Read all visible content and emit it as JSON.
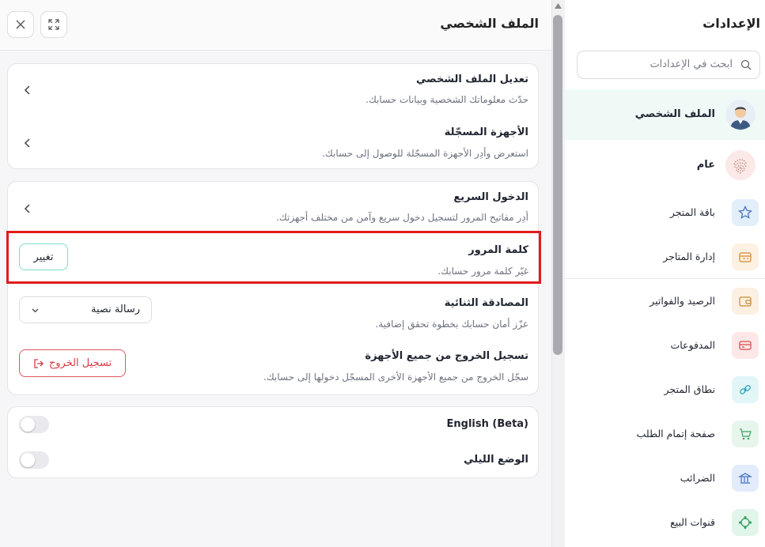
{
  "panel": {
    "title": "الملف الشخصي",
    "close_icon": "close-icon",
    "expand_icon": "expand-icon"
  },
  "account_card": {
    "items": [
      {
        "title": "تعديل الملف الشخصي",
        "desc": "حدّث معلوماتك الشخصية وبيانات حسابك."
      },
      {
        "title": "الأجهزة المسجّلة",
        "desc": "استعرض وأدِر الأجهزة المسجّلة للوصول إلى حسابك."
      }
    ]
  },
  "security_card": {
    "quick_login": {
      "title": "الدخول السريع",
      "desc": "أدِر مفاتيح المرور لتسجيل دخول سريع وآمن من مختلف أجهزتك."
    },
    "password": {
      "title": "كلمة المرور",
      "desc": "غيّر كلمة مرور حسابك.",
      "button": "تغيير"
    },
    "two_factor": {
      "title": "المصادقة الثنائية",
      "desc": "عزّز أمان حسابك بخطوة تحقق إضافية.",
      "selected": "رسالة نصية"
    },
    "logout_all": {
      "title": "تسجيل الخروج من جميع الأجهزة",
      "desc": "سجّل الخروج من جميع الأجهزة الأخرى المسجّل دخولها إلى حسابك.",
      "button": "تسجيل الخروج"
    }
  },
  "prefs_card": {
    "english": {
      "label": "English (Beta)",
      "on": false
    },
    "dark_mode": {
      "label": "الوضع الليلي",
      "on": false
    }
  },
  "colors": {
    "highlight": "#e01b1b",
    "accent": "#7ddcc9",
    "danger": "#d83a44",
    "active_bg": "#effaf7"
  },
  "sidebar": {
    "title": "الإعدادات",
    "search_placeholder": "ابحث في الإعدادات",
    "items": [
      {
        "label": "الملف الشخصي",
        "icon": "user-avatar",
        "active": true
      },
      {
        "label": "عام",
        "icon": "fingerprint-icon"
      },
      {
        "label": "باقة المتجر",
        "icon": "star-icon"
      },
      {
        "label": "إدارة المتاجر",
        "icon": "store-manage-icon"
      },
      {
        "label": "الرصيد والفواتير",
        "icon": "wallet-icon"
      },
      {
        "label": "المدفوعات",
        "icon": "card-icon"
      },
      {
        "label": "نطاق المتجر",
        "icon": "link-icon"
      },
      {
        "label": "صفحة إتمام الطلب",
        "icon": "cart-icon"
      },
      {
        "label": "الضرائب",
        "icon": "tax-icon"
      },
      {
        "label": "قنوات البيع",
        "icon": "channels-icon"
      }
    ]
  }
}
